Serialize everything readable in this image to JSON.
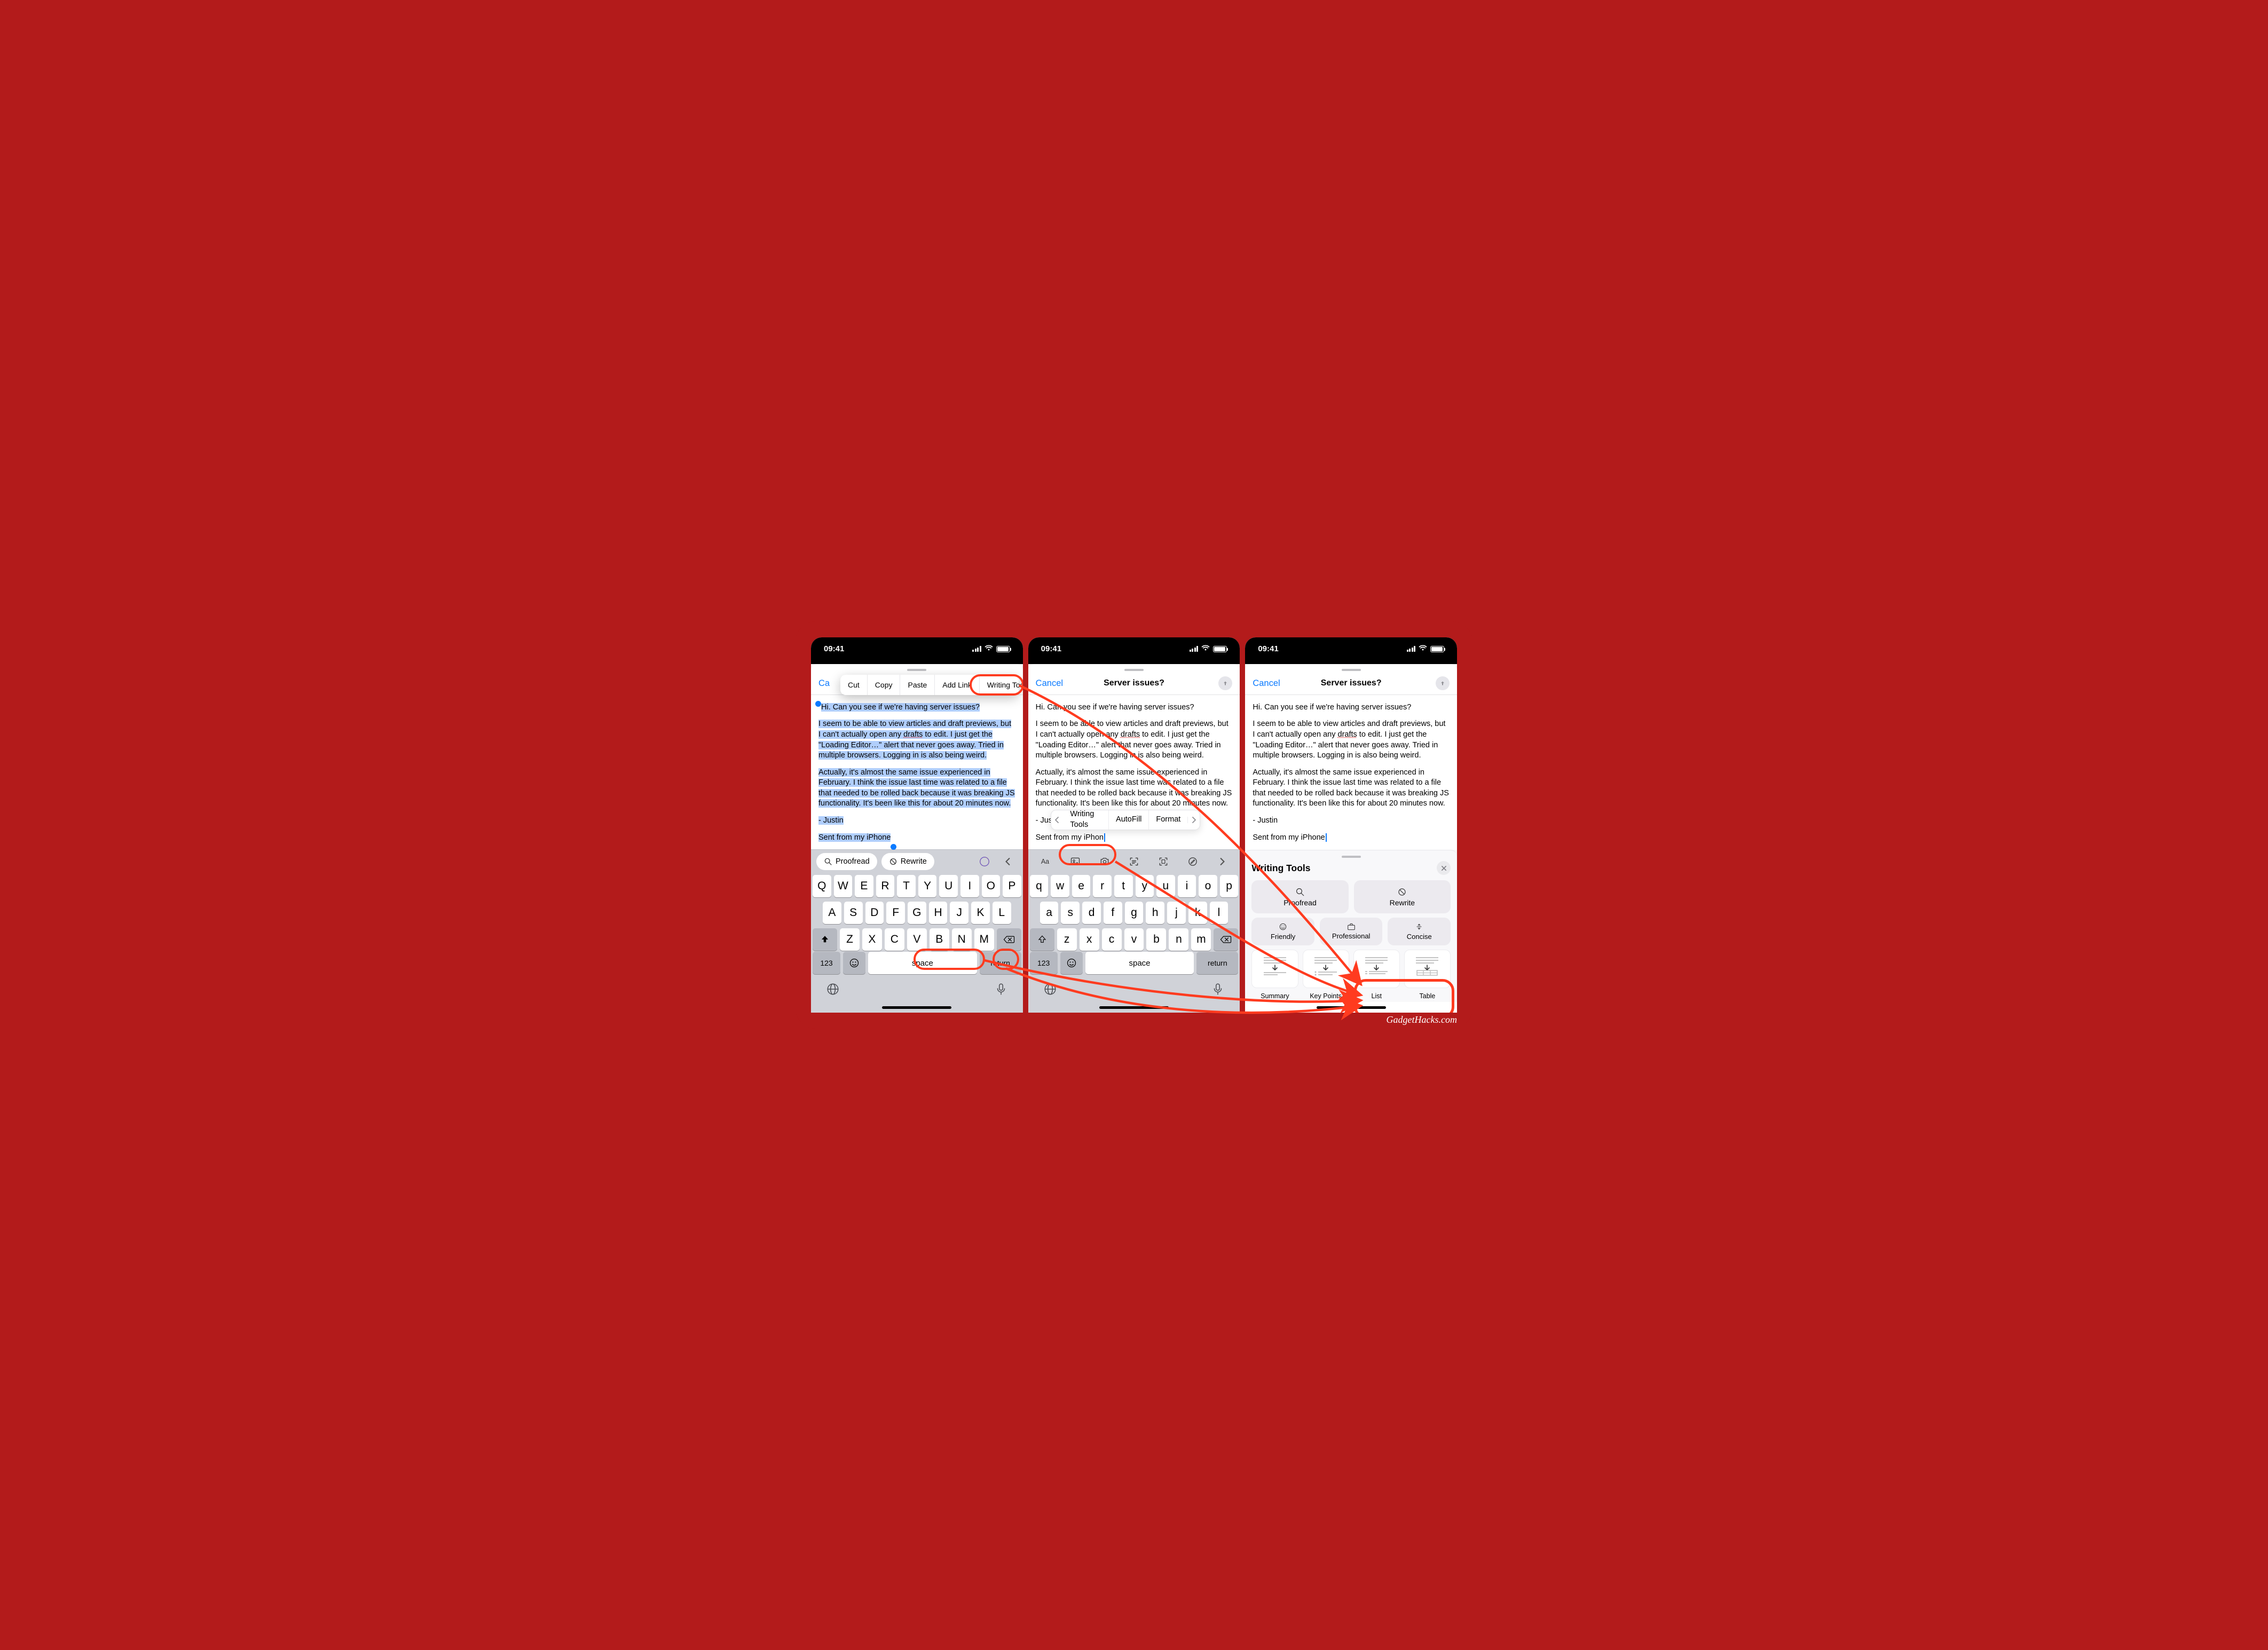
{
  "status": {
    "time": "09:41"
  },
  "nav": {
    "cancel": "Cancel",
    "title": "Server issues?",
    "title_short": "Ca"
  },
  "edit_menu": {
    "cut": "Cut",
    "copy": "Copy",
    "paste": "Paste",
    "add_link": "Add Link",
    "writing_tools": "Writing Tools"
  },
  "inline_menu": {
    "writing_tools": "Writing Tools",
    "autofill": "AutoFill",
    "format": "Format"
  },
  "compose": {
    "p1": "Hi. Can you see if we're having server issues?",
    "p2": "I seem to be able to view articles and draft previews, but I can't actually open any drafts to edit. I just get the \"Loading Editor…\" alert that never goes away. Tried in multiple browsers. Logging in is also being weird.",
    "p3": "Actually, it's almost the same issue experienced in February. I think the issue last time was related to a file that needed to be rolled back because it was breaking JS functionality. It's been like this for about 20 minutes now.",
    "sig": "- Justin",
    "sig_prefix": "- Jus",
    "sent": "Sent from my iPhone",
    "sent_prefix": "Sent from my iPhon"
  },
  "accessory": {
    "proofread": "Proofread",
    "rewrite": "Rewrite"
  },
  "keyboard": {
    "row1_upper": [
      "Q",
      "W",
      "E",
      "R",
      "T",
      "Y",
      "U",
      "I",
      "O",
      "P"
    ],
    "row2_upper": [
      "A",
      "S",
      "D",
      "F",
      "G",
      "H",
      "J",
      "K",
      "L"
    ],
    "row3_upper": [
      "Z",
      "X",
      "C",
      "V",
      "B",
      "N",
      "M"
    ],
    "row1_lower": [
      "q",
      "w",
      "e",
      "r",
      "t",
      "y",
      "u",
      "i",
      "o",
      "p"
    ],
    "row2_lower": [
      "a",
      "s",
      "d",
      "f",
      "g",
      "h",
      "j",
      "k",
      "l"
    ],
    "row3_lower": [
      "z",
      "x",
      "c",
      "v",
      "b",
      "n",
      "m"
    ],
    "k123": "123",
    "space": "space",
    "return": "return"
  },
  "writing_tools": {
    "title": "Writing Tools",
    "proofread": "Proofread",
    "rewrite": "Rewrite",
    "friendly": "Friendly",
    "professional": "Professional",
    "concise": "Concise",
    "summary": "Summary",
    "keypoints": "Key Points",
    "list": "List",
    "table": "Table"
  },
  "watermark": "GadgetHacks.com"
}
